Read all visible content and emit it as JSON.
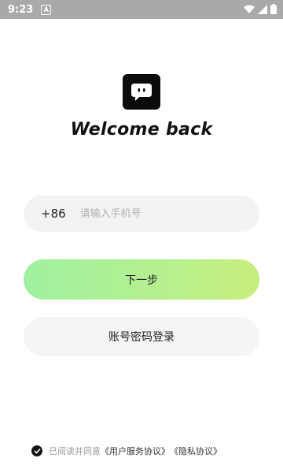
{
  "status_bar": {
    "time": "9:23",
    "notification_icon": "a-icon",
    "icons": [
      "wifi-icon",
      "signal-icon",
      "battery-icon"
    ]
  },
  "logo": {
    "icon": "chat-bubble-face-icon"
  },
  "welcome": {
    "title": "Welcome back"
  },
  "phone": {
    "country_code": "+86",
    "placeholder": "请输入手机号"
  },
  "buttons": {
    "next_label": "下一步",
    "password_login_label": "账号密码登录"
  },
  "agreement": {
    "prefix": "已阅读并同意",
    "user_agreement": "《用户服务协议》",
    "privacy_agreement": "《隐私协议》"
  },
  "colors": {
    "accent_start": "#9ff0a0",
    "accent_end": "#c7ed7b",
    "input_bg": "#f3f3f3",
    "secondary_btn_bg": "#f5f5f5"
  }
}
